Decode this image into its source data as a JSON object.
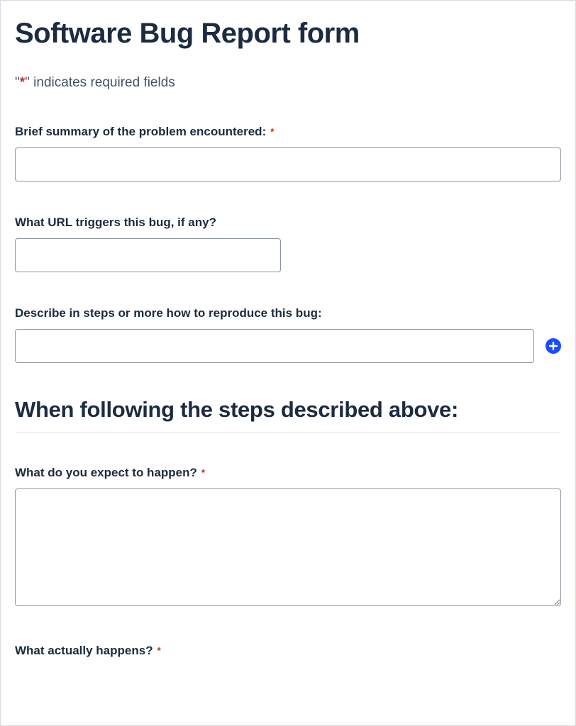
{
  "title": "Software Bug Report form",
  "required_note": {
    "prefix": "\"",
    "asterisk": "*",
    "suffix": "\" indicates required fields"
  },
  "fields": {
    "summary": {
      "label": "Brief summary of the problem encountered:",
      "required_mark": "*",
      "value": ""
    },
    "url": {
      "label": "What URL triggers this bug, if any?",
      "value": ""
    },
    "steps": {
      "label": "Describe in steps or more how to reproduce this bug:",
      "value": ""
    }
  },
  "section2": {
    "heading": "When following the steps described above:"
  },
  "fields2": {
    "expect": {
      "label": "What do you expect to happen?",
      "required_mark": "*",
      "value": ""
    },
    "actual": {
      "label": "What actually happens?",
      "required_mark": "*",
      "value": ""
    }
  }
}
